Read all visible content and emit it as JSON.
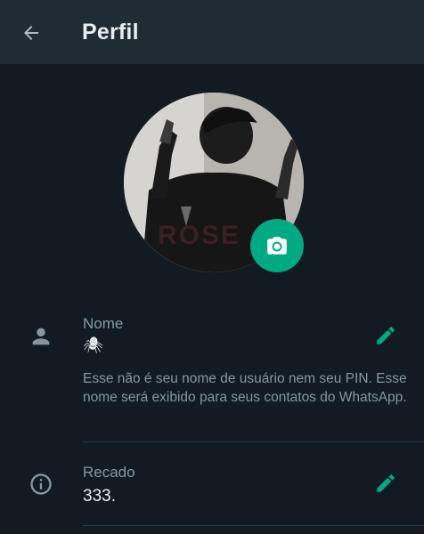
{
  "appbar": {
    "title": "Perfil"
  },
  "profile": {
    "name_label": "Nome",
    "name_value": "🕷",
    "name_help": "Esse não é seu nome de usuário nem seu PIN. Esse nome será exibido para seus contatos do WhatsApp.",
    "about_label": "Recado",
    "about_value": "333."
  },
  "colors": {
    "accent": "#00a884",
    "background": "#121b22",
    "appbar": "#202c33",
    "muted_text": "#8696a0",
    "primary_text": "#e9edef"
  },
  "icons": {
    "back": "arrow-left-icon",
    "camera": "camera-icon",
    "person": "person-icon",
    "info": "info-icon",
    "edit": "pencil-icon"
  }
}
